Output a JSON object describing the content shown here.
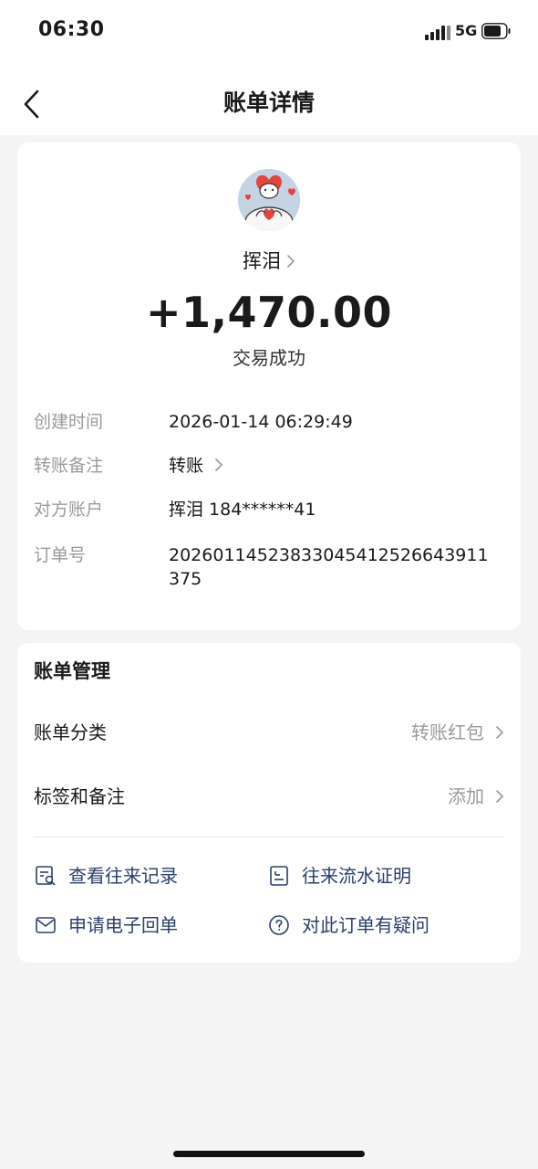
{
  "status_bar": {
    "time": "06:30",
    "network": "5G"
  },
  "nav": {
    "title": "账单详情",
    "back_icon": "chevron-left-icon"
  },
  "payer": {
    "name": "挥泪",
    "avatar_icon": "heart-hands-avatar"
  },
  "amount": "+1,470.00",
  "status": "交易成功",
  "details": [
    {
      "label": "创建时间",
      "value": "2026-01-14 06:29:49",
      "has_chevron": false
    },
    {
      "label": "转账备注",
      "value": "转账",
      "has_chevron": true
    },
    {
      "label": "对方账户",
      "value": "挥泪 184******41",
      "has_chevron": false
    },
    {
      "label": "订单号",
      "value": "2026011452383304541252664391 1375",
      "has_chevron": false
    }
  ],
  "order_no_lines": [
    "2026011452383304541252664391​1",
    "375"
  ],
  "manage": {
    "title": "账单管理",
    "rows": [
      {
        "label": "账单分类",
        "value": "转账红包"
      },
      {
        "label": "标签和备注",
        "value": "添加"
      }
    ],
    "actions": [
      {
        "label": "查看往来记录",
        "icon": "record-search-icon"
      },
      {
        "label": "往来流水证明",
        "icon": "statement-icon"
      },
      {
        "label": "申请电子回单",
        "icon": "mail-icon"
      },
      {
        "label": "对此订单有疑问",
        "icon": "question-circle-icon"
      }
    ]
  },
  "colors": {
    "page_bg": "#f4f4f4",
    "card_bg": "#ffffff",
    "label_gray": "#9a9a9a",
    "action_blue": "#2b3f6b"
  }
}
